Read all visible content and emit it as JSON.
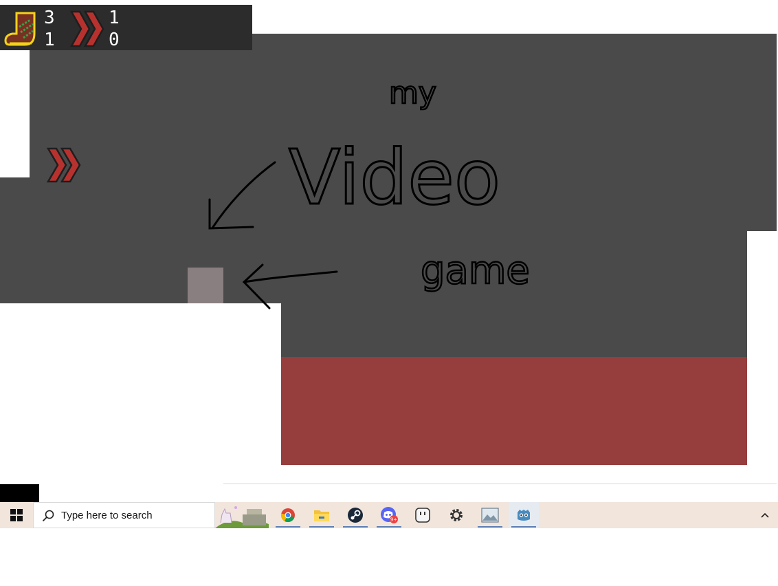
{
  "hud": {
    "boot_count": "3",
    "boot_sub": "1",
    "dash_count": "1",
    "dash_sub": "0"
  },
  "annotation": {
    "line1": "my",
    "line2": "Video",
    "line3": "game"
  },
  "colors": {
    "level": "#4a4a4a",
    "lava": "#963d3d",
    "player": "#8a7f80",
    "dash_red": "#b7322e",
    "boot_yellow": "#f2d21b"
  },
  "taskbar": {
    "search_placeholder": "Type here to search",
    "apps": [
      {
        "name": "chrome-icon"
      },
      {
        "name": "file-explorer-icon"
      },
      {
        "name": "steam-icon"
      },
      {
        "name": "discord-icon",
        "badge": "9+"
      },
      {
        "name": "smiley-app-icon"
      },
      {
        "name": "settings-gear-icon"
      },
      {
        "name": "photos-icon"
      },
      {
        "name": "godot-icon"
      }
    ]
  }
}
